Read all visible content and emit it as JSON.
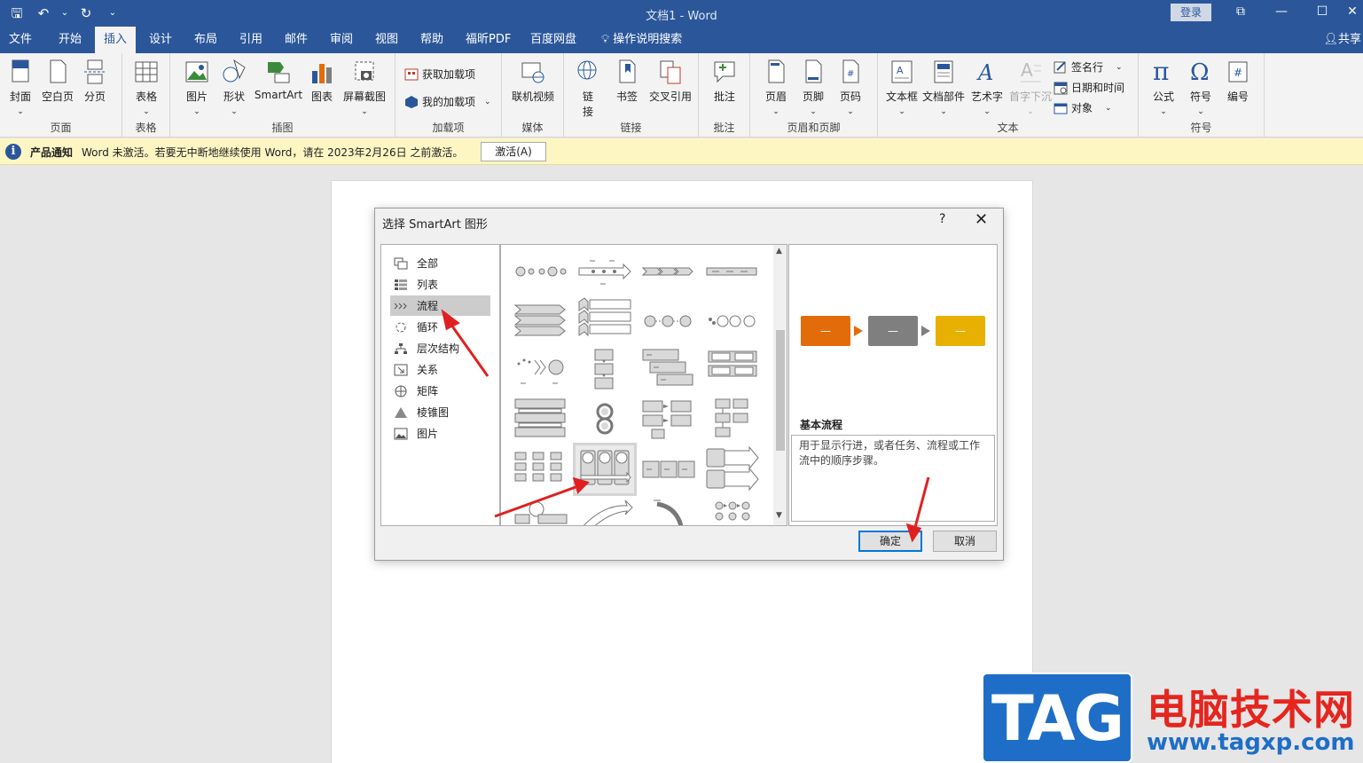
{
  "titlebar": {
    "doc_title": "文档1  -  Word",
    "login": "登录",
    "qat": {
      "save": "🖫",
      "undo": "↶",
      "undo_menu": "⌄",
      "redo": "↻",
      "customize": "⌄"
    },
    "controls": {
      "ribbon_opts": "⧉",
      "minimize": "—",
      "maximize": "☐",
      "close": "✕"
    }
  },
  "tabs": [
    "文件",
    "开始",
    "插入",
    "设计",
    "布局",
    "引用",
    "邮件",
    "审阅",
    "视图",
    "帮助",
    "福昕PDF",
    "百度网盘"
  ],
  "active_tab": "插入",
  "tell_me": "操作说明搜索",
  "share": "共享",
  "ribbon": {
    "pages": {
      "label": "页面",
      "cover": "封面",
      "blank": "空白页",
      "break": "分页"
    },
    "tables": {
      "label": "表格",
      "table": "表格"
    },
    "illustrations": {
      "label": "插图",
      "picture": "图片",
      "shapes": "形状",
      "smartart": "SmartArt",
      "chart": "图表",
      "screenshot": "屏幕截图"
    },
    "addins": {
      "label": "加载项",
      "get": "获取加载项",
      "my": "我的加载项"
    },
    "media": {
      "label": "媒体",
      "online_video": "联机视频"
    },
    "links": {
      "label": "链接",
      "link_line1": "链",
      "link_line2": "接",
      "bookmark": "书签",
      "cross_ref": "交叉引用"
    },
    "comments": {
      "label": "批注",
      "comment": "批注"
    },
    "header_footer": {
      "label": "页眉和页脚",
      "header": "页眉",
      "footer": "页脚",
      "page_num": "页码"
    },
    "text": {
      "label": "文本",
      "textbox": "文本框",
      "quickparts": "文档部件",
      "wordart": "艺术字",
      "dropcap": "首字下沉",
      "signature": "签名行",
      "datetime": "日期和时间",
      "object": "对象"
    },
    "symbols": {
      "label": "符号",
      "equation": "公式",
      "symbol": "符号",
      "number": "编号"
    }
  },
  "notification": {
    "title": "产品通知",
    "message": "Word 未激活。若要无中断地继续使用 Word，请在 2023年2月26日 之前激活。",
    "button": "激活(A)"
  },
  "dialog": {
    "title": "选择 SmartArt 图形",
    "help": "?",
    "close": "✕",
    "categories": [
      "全部",
      "列表",
      "流程",
      "循环",
      "层次结构",
      "关系",
      "矩阵",
      "棱锥图",
      "图片"
    ],
    "selected_category": "流程",
    "preview": {
      "name": "基本流程",
      "description": "用于显示行进，或者任务、流程或工作流中的顺序步骤。",
      "box_text": "—",
      "colors": [
        "#e36c0a",
        "#7f7f7f",
        "#e8b000"
      ]
    },
    "scroll_up": "▲",
    "scroll_down": "▼",
    "ok": "确定",
    "cancel": "取消"
  },
  "watermark": {
    "tag": "TAG",
    "cn": "电脑技术网",
    "url": "www.tagxp.com"
  }
}
